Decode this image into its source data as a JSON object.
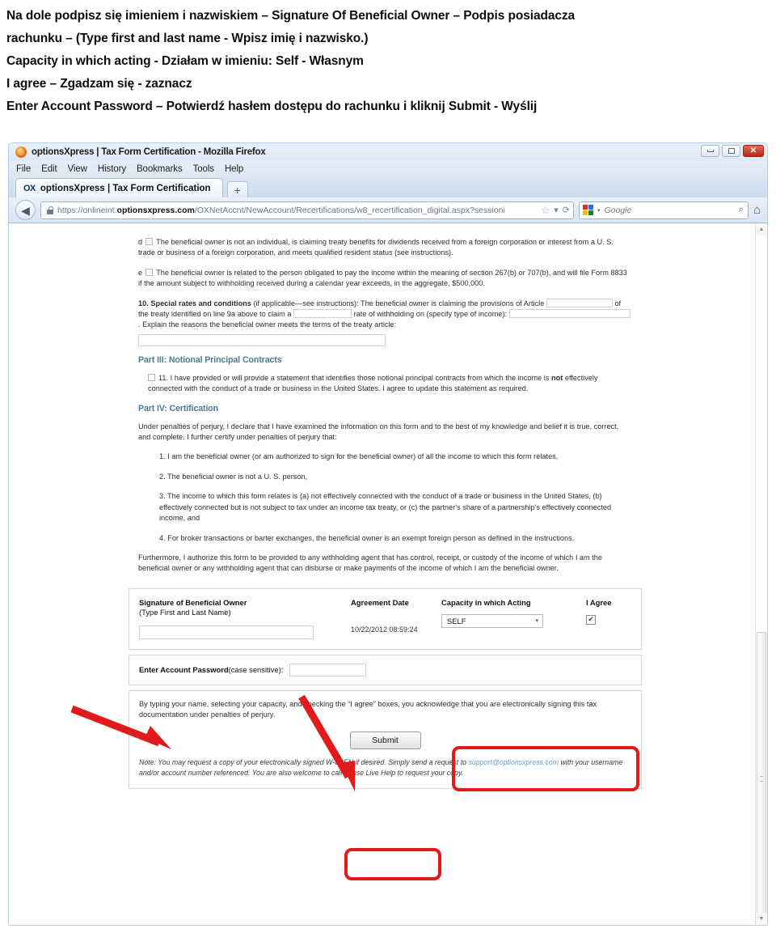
{
  "instructions": {
    "lines": [
      "Na dole podpisz się imieniem i nazwiskiem – Signature Of Beneficial Owner – Podpis posiadacza",
      "rachunku – (Type first and last name - Wpisz imię i nazwisko.)",
      "Capacity in which acting - Działam w imieniu: Self - Własnym",
      "I agree – Zgadzam się - zaznacz",
      "Enter Account Password – Potwierdź hasłem dostępu do rachunku i kliknij Submit - Wyślij"
    ]
  },
  "browser": {
    "window_title": "optionsXpress | Tax Form Certification - Mozilla Firefox",
    "menu": [
      "File",
      "Edit",
      "View",
      "History",
      "Bookmarks",
      "Tools",
      "Help"
    ],
    "tab": {
      "badge": "OX",
      "label": "optionsXpress | Tax Form Certification",
      "newtab": "+"
    },
    "controls": {
      "minimize": "–",
      "maximize": "□",
      "close": "✕"
    },
    "url": {
      "scheme": "https://onlineint.",
      "host": "optionsxpress.com",
      "path": "/OXNetAccnt/NewAccount/Recertifications/w8_recertification_digital.aspx?sessioni"
    },
    "search": {
      "engine": "Google",
      "placeholder": "Google"
    },
    "icons": {
      "back": "◀",
      "reload": "⟳",
      "star": "☆",
      "dropdown": "▾",
      "magnifier": "⌕",
      "home": "⌂"
    }
  },
  "form": {
    "item_d": {
      "letter": "d",
      "text": "The beneficial owner is not an individual, is claiming treaty benefits for dividends received from a foreign corporation or interest from a U. S. trade or business of a foreign corporation, and meets qualified resident status (see instructions)."
    },
    "item_e": {
      "letter": "e",
      "text": "The beneficial owner is related to the person obligated to pay the income within the meaning of section 267(b) or 707(b), and will file Form 8833 if the amount subject to withholding received during a calendar year exceeds, in the aggregate, $500,000."
    },
    "item_10": {
      "lead_bold": "10. Special rates and conditions",
      "lead_rest": " (if applicable—see instructions): The beneficial owner is claiming the provisions of",
      "article_label": "Article",
      "mid1": "of the treaty identified on line 9a above to claim a",
      "mid2": "rate of withholding on (specify type of",
      "income_label": "income):",
      "tail": ". Explain the reasons the beneficial owner meets the terms of the treaty article:"
    },
    "part3": {
      "heading": "Part III: Notional Principal Contracts",
      "text_a": "11. I have provided or will provide a statement that identifies those notional principal contracts from which the income is ",
      "text_bold": "not",
      "text_b": " effectively connected with the conduct of a trade or business in the United States. I agree to update this statement as required."
    },
    "part4": {
      "heading": "Part IV: Certification",
      "intro": "Under penalties of perjury, I declare that I have examined the information on this form and to the best of my knowledge and belief it is true, correct, and complete. I further certify under penalties of perjury that:",
      "items": [
        "1. I am the beneficial owner (or am authorized to sign for the beneficial owner) of all the income to which this form relates,",
        "2. The beneficial owner is not a U. S. person,",
        "3. The income to which this form relates is (a) not effectively connected with the conduct of a trade or business in the United States, (b) effectively connected but is not subject to tax under an income tax treaty, or (c) the partner's share of a partnership's effectively connected income, and",
        "4. For broker transactions or barter exchanges, the beneficial owner is an exempt foreign person as defined in the instructions."
      ],
      "furthermore": "Furthermore, I authorize this form to be provided to any withholding agent that has control, receipt, or custody of the income of which I am the beneficial owner or any withholding agent that can disburse or make payments of the income of which I am the beneficial owner."
    },
    "signature": {
      "label": "Signature of Beneficial Owner",
      "sublabel": "(Type First and Last Name)",
      "value": "",
      "date_label": "Agreement Date",
      "date_value": "10/22/2012 08:59:24",
      "capacity_label": "Capacity in which Acting",
      "capacity_value": "SELF",
      "capacity_caret": "▾",
      "agree_label": "I Agree",
      "agree_checked": "✔"
    },
    "password": {
      "label_bold": "Enter Account Password",
      "label_rest": "(case sensitive):",
      "value": ""
    },
    "acknowledgement": "By typing your name, selecting your capacity, and checking the “I agree” boxes, you acknowledge that you are electronically signing this tax documentation under penalties of perjury.",
    "submit_label": "Submit",
    "note": {
      "lead": "Note:  You may request a copy of your electronically signed W-8BEN if desired.  Simply send a request to ",
      "email": "support@optionsxpress.com",
      "tail": " with your username and/or account number referenced.  You are also welcome to call or use Live Help to request your copy."
    }
  },
  "colors": {
    "annotation_red": "#e01b1b",
    "part_heading": "#4a7c94"
  }
}
